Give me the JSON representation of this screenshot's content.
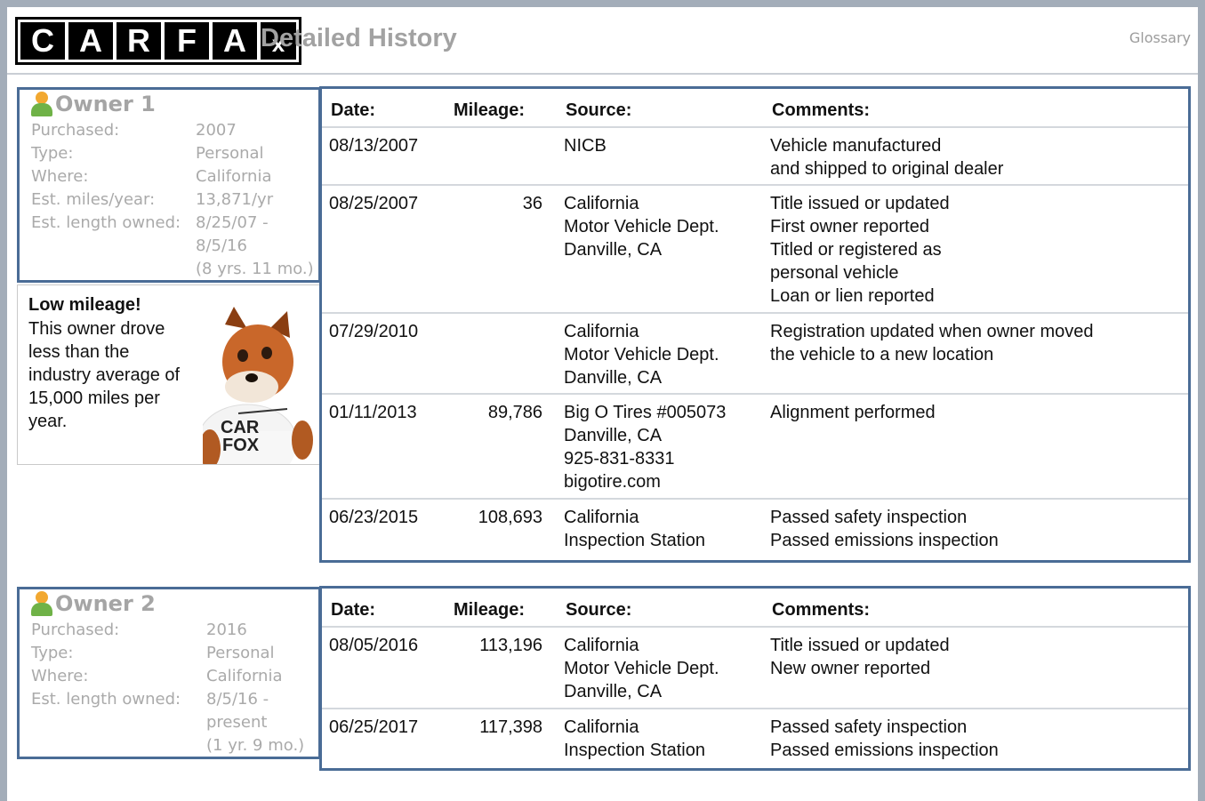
{
  "header": {
    "logo_letters": [
      "C",
      "A",
      "R",
      "F",
      "A",
      "x"
    ],
    "title": "Detailed History",
    "glossary_link": "Glossary"
  },
  "columns": {
    "date": "Date:",
    "mileage": "Mileage:",
    "source": "Source:",
    "comments": "Comments:"
  },
  "owners": [
    {
      "name": "Owner 1",
      "fields": [
        {
          "label": "Purchased:",
          "value": [
            "2007"
          ]
        },
        {
          "label": "Type:",
          "value": [
            "Personal"
          ]
        },
        {
          "label": "Where:",
          "value": [
            "California"
          ]
        },
        {
          "label": "Est. miles/year:",
          "value": [
            "13,871/yr"
          ]
        },
        {
          "label": "Est. length owned:",
          "value": [
            "8/25/07 -",
            "8/5/16",
            "(8 yrs. 11 mo.)"
          ]
        }
      ],
      "callout": {
        "title": "Low mileage!",
        "text": "This owner drove less than the industry average of 15,000 miles per year.",
        "mascot_shirt": [
          "CAR",
          "FOX"
        ]
      },
      "records": [
        {
          "date": "08/13/2007",
          "mileage": "",
          "source": [
            "NICB"
          ],
          "comments": [
            "Vehicle manufactured",
            "and shipped to original dealer"
          ]
        },
        {
          "date": "08/25/2007",
          "mileage": "36",
          "source": [
            "California",
            "Motor Vehicle Dept.",
            "Danville, CA"
          ],
          "comments": [
            "Title issued or updated",
            "First owner reported",
            "Titled or registered as",
            "personal vehicle",
            "Loan or lien reported"
          ]
        },
        {
          "date": "07/29/2010",
          "mileage": "",
          "source": [
            "California",
            "Motor Vehicle Dept.",
            "Danville, CA"
          ],
          "comments": [
            "Registration updated when owner moved",
            "the vehicle to a new location"
          ]
        },
        {
          "date": "01/11/2013",
          "mileage": "89,786",
          "source": [
            "Big O Tires #005073",
            "Danville, CA",
            "925-831-8331",
            "bigotire.com"
          ],
          "comments": [
            "Alignment performed"
          ]
        },
        {
          "date": "06/23/2015",
          "mileage": "108,693",
          "source": [
            "California",
            "Inspection Station"
          ],
          "comments": [
            "Passed safety inspection",
            "Passed emissions inspection"
          ]
        }
      ]
    },
    {
      "name": "Owner 2",
      "fields": [
        {
          "label": "Purchased:",
          "value": [
            "2016"
          ]
        },
        {
          "label": "Type:",
          "value": [
            "Personal"
          ]
        },
        {
          "label": "Where:",
          "value": [
            "California"
          ]
        },
        {
          "label": "Est. length owned:",
          "value": [
            "8/5/16 -",
            "present",
            "(1 yr. 9 mo.)"
          ]
        }
      ],
      "records": [
        {
          "date": "08/05/2016",
          "mileage": "113,196",
          "source": [
            "California",
            "Motor Vehicle Dept.",
            "Danville, CA"
          ],
          "comments": [
            "Title issued or updated",
            "New owner reported"
          ]
        },
        {
          "date": "06/25/2017",
          "mileage": "117,398",
          "source": [
            "California",
            "Inspection Station"
          ],
          "comments": [
            "Passed safety inspection",
            "Passed emissions inspection"
          ]
        }
      ]
    }
  ],
  "colors": {
    "frame": "#a3adb9",
    "card_border": "#4a6c96",
    "muted_text": "#aaaaaa",
    "title_gray": "#a2a2a2"
  }
}
